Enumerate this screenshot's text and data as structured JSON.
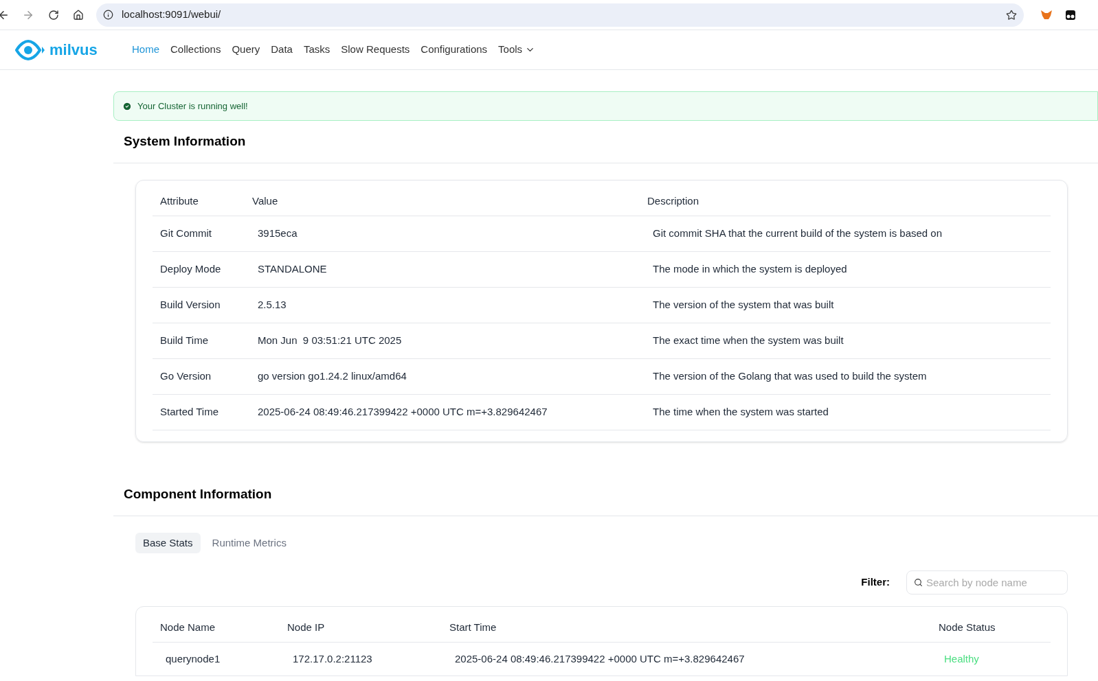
{
  "browser": {
    "url": "localhost:9091/webui/"
  },
  "nav": {
    "logo": "milvus",
    "items": [
      {
        "label": "Home",
        "selected": true
      },
      {
        "label": "Collections",
        "selected": false
      },
      {
        "label": "Query",
        "selected": false
      },
      {
        "label": "Data",
        "selected": false
      },
      {
        "label": "Tasks",
        "selected": false
      },
      {
        "label": "Slow Requests",
        "selected": false
      },
      {
        "label": "Configurations",
        "selected": false
      },
      {
        "label": "Tools",
        "selected": false,
        "kind": "dropdown"
      }
    ]
  },
  "alert": {
    "text": "Your Cluster is running well!"
  },
  "system_information": {
    "title": "System Information",
    "columns": [
      "Attribute",
      "Value",
      "Description"
    ],
    "rows": [
      {
        "attribute": "Git Commit",
        "value": "3915eca",
        "description": "Git commit SHA that the current build of the system is based on"
      },
      {
        "attribute": "Deploy Mode",
        "value": "STANDALONE",
        "description": "The mode in which the system is deployed"
      },
      {
        "attribute": "Build Version",
        "value": "2.5.13",
        "description": "The version of the system that was built"
      },
      {
        "attribute": "Build Time",
        "value": "Mon Jun  9 03:51:21 UTC 2025",
        "description": "The exact time when the system was built"
      },
      {
        "attribute": "Go Version",
        "value": "go version go1.24.2 linux/amd64",
        "description": "The version of the Golang that was used to build the system"
      },
      {
        "attribute": "Started Time",
        "value": "2025-06-24 08:49:46.217399422 +0000 UTC m=+3.829642467",
        "description": "The time when the system was started"
      }
    ]
  },
  "component_information": {
    "title": "Component Information",
    "tabs": [
      {
        "label": "Base Stats",
        "selected": true
      },
      {
        "label": "Runtime Metrics",
        "selected": false
      }
    ],
    "filter": {
      "label": "Filter:",
      "placeholder": "Search by node name"
    },
    "columns": [
      "Node Name",
      "Node IP",
      "Start Time",
      "Node Status"
    ],
    "rows": [
      {
        "name": "querynode1",
        "ip": "172.17.0.2:21123",
        "start_time": "2025-06-24 08:49:46.217399422 +0000 UTC m=+3.829642467",
        "status": "Healthy",
        "color": "#4ade80"
      }
    ]
  }
}
